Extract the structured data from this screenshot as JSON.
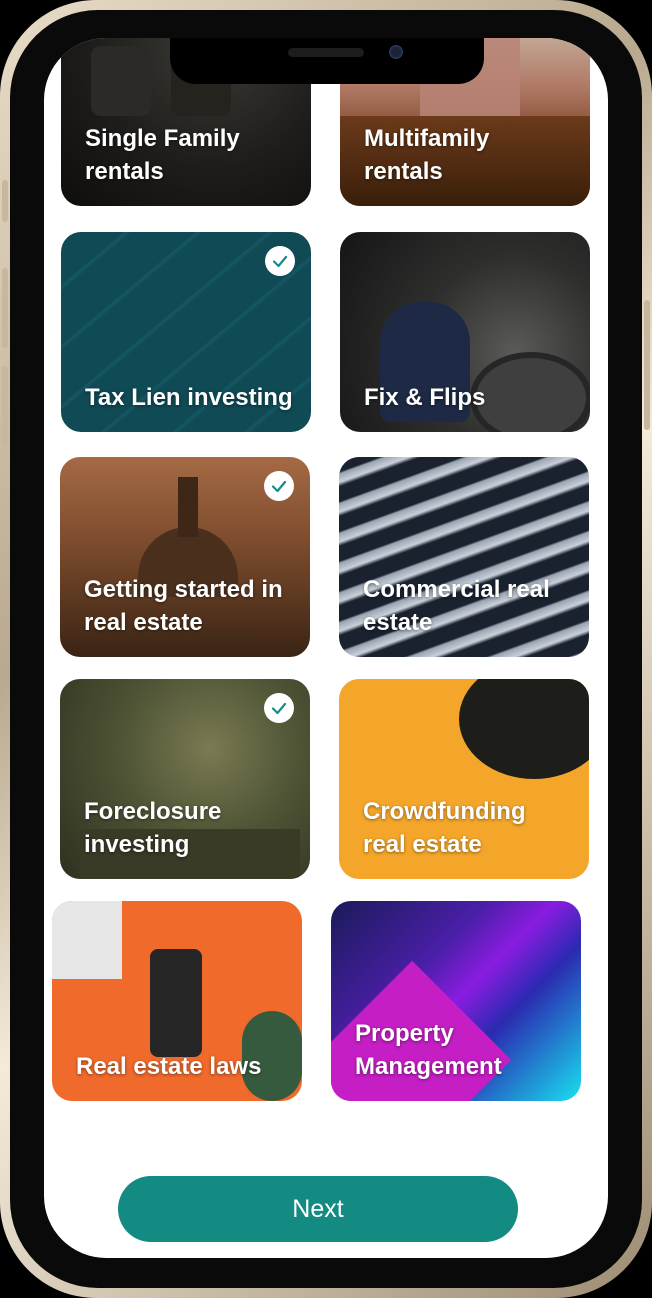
{
  "cards": [
    {
      "label": "Single Family rentals",
      "selected": false
    },
    {
      "label": "Multifamily rentals",
      "selected": false
    },
    {
      "label": "Tax Lien investing",
      "selected": true
    },
    {
      "label": "Fix & Flips",
      "selected": false
    },
    {
      "label": "Getting started in real estate",
      "selected": true
    },
    {
      "label": "Commercial real estate",
      "selected": false
    },
    {
      "label": "Foreclosure investing",
      "selected": true
    },
    {
      "label": "Crowdfunding real estate",
      "selected": false
    },
    {
      "label": "Real estate laws",
      "selected": false
    },
    {
      "label": "Property Management",
      "selected": false
    }
  ],
  "next_button": {
    "label": "Next"
  },
  "colors": {
    "accent": "#138a82",
    "check": "#1a8a86"
  }
}
